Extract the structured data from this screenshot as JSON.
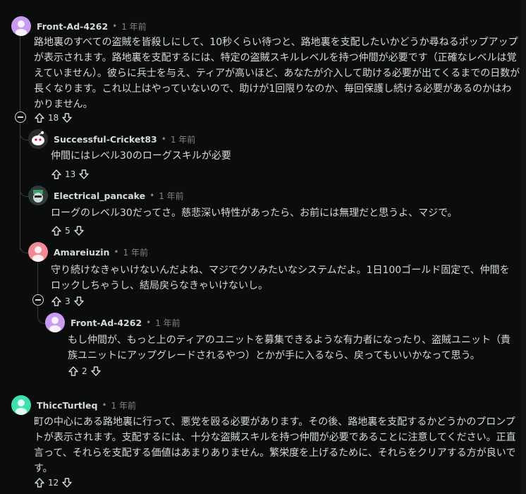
{
  "comments": [
    {
      "username": "Front-Ad-4262",
      "time": "1 年前",
      "text": "路地裏のすべての盗賊を皆殺しにして、10秒くらい待つと、路地裏を支配したいかどうか尋ねるポップアップが表示されます。路地裏を支配するには、特定の盗賊スキルレベルを持つ仲間が必要です（正確なレベルは覚えていません）。彼らに兵士を与え、ティアが高いほど、あなたが介入して助ける必要が出てくるまでの日数が長くなります。これ以上はやっていないので、助けが1回限りなのか、毎回保護し続ける必要があるのかはわかりません。",
      "score": "18",
      "avatar_color": "#c89bf0"
    },
    {
      "username": "Successful-Cricket83",
      "time": "1 年前",
      "text": "仲間にはレベル30のローグスキルが必要",
      "score": "13",
      "avatar_color": "#2a2b2c"
    },
    {
      "username": "Electrical_pancake",
      "time": "1 年前",
      "text": "ローグのレベル30だってさ。慈悲深い特性があったら、お前には無理だと思うよ、マジで。",
      "score": "5",
      "avatar_color": "#2e3b3a"
    },
    {
      "username": "Amareiuzin",
      "time": "1 年前",
      "text": "守り続けなきゃいけないんだよね、マジでクソみたいなシステムだよ。1日100ゴールド固定で、仲間をロックしちゃうし、結局戻らなきゃいけないし。",
      "score": "3",
      "avatar_color": "#f08a97"
    },
    {
      "username": "Front-Ad-4262",
      "time": "1 年前",
      "text": "もし仲間が、もっと上のティアのユニットを募集できるような有力者になったり、盗賊ユニット（貴族ユニットにアップグレードされるやつ）とかが手に入るなら、戻ってもいいかなって思う。",
      "score": "2",
      "avatar_color": "#c89bf0"
    },
    {
      "username": "ThiccTurtleq",
      "time": "1 年前",
      "text": "町の中心にある路地裏に行って、悪党を殴る必要があります。その後、路地裏を支配するかどうかのプロンプトが表示されます。支配するには、十分な盗賊スキルを持つ仲間が必要であることに注意してください。正直言って、それらを支配する価値はあまりありません。繁栄度を上げるために、それらをクリアする方が良いです。",
      "score": "12",
      "avatar_color": "#3ee0b0"
    }
  ],
  "separator": "•",
  "icons": {
    "upvote": "arrow-up-icon",
    "downvote": "arrow-down-icon",
    "collapse": "collapse-minus-icon"
  }
}
